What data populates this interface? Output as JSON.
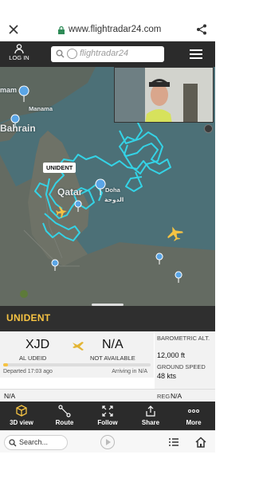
{
  "browser": {
    "url": "www.flightradar24.com"
  },
  "header": {
    "login_label": "LOG IN",
    "logo_text": "flightradar24"
  },
  "map": {
    "labels": [
      "mam",
      "Manama",
      "Bahrain",
      "Qatar",
      "Doha",
      "الدوحة"
    ],
    "callsign_tag": "UNIDENT"
  },
  "flight": {
    "callsign": "UNIDENT",
    "origin": {
      "code": "XJD",
      "name": "AL UDEID"
    },
    "destination": {
      "code": "N/A",
      "name": "NOT AVAILABLE"
    },
    "progress": 0.02,
    "departed": "Departed 17:03 ago",
    "arriving": "Arriving in N/A",
    "baro_alt_label": "BAROMETRIC ALT.",
    "baro_alt_value": "12,000 ft",
    "ground_speed_label": "GROUND SPEED",
    "ground_speed_value": "48 kts",
    "aircraft_type": "N/A",
    "reg_label": "REG",
    "reg_value": "N/A"
  },
  "actions": [
    {
      "label": "3D view",
      "icon": "cube-icon"
    },
    {
      "label": "Route",
      "icon": "route-icon"
    },
    {
      "label": "Follow",
      "icon": "follow-icon"
    },
    {
      "label": "Share",
      "icon": "share-icon"
    },
    {
      "label": "More",
      "icon": "more-icon"
    }
  ],
  "bottom": {
    "search_label": "Search..."
  },
  "colors": {
    "accent": "#f6c343",
    "track": "#34d3e6",
    "map_water": "#4c7077",
    "map_land": "#636b63"
  }
}
